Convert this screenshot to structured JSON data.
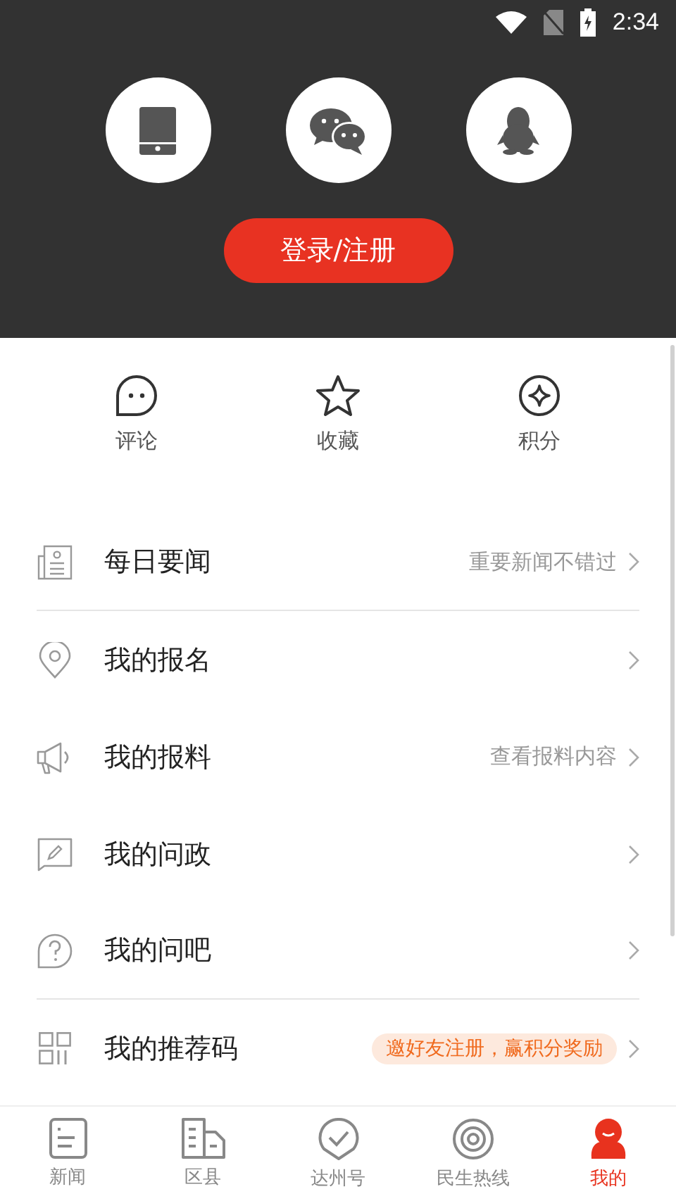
{
  "status_bar": {
    "time": "2:34"
  },
  "login": {
    "button": "登录/注册"
  },
  "quick_actions": [
    {
      "label": "评论"
    },
    {
      "label": "收藏"
    },
    {
      "label": "积分"
    }
  ],
  "menu": [
    {
      "title": "每日要闻",
      "hint": "重要新闻不错过",
      "divider_after": true
    },
    {
      "title": "我的报名",
      "divider_after": false
    },
    {
      "title": "我的报料",
      "hint": "查看报料内容",
      "divider_after": false
    },
    {
      "title": "我的问政",
      "divider_after": false
    },
    {
      "title": "我的问吧",
      "divider_after": true
    },
    {
      "title": "我的推荐码",
      "badge": "邀好友注册，赢积分奖励",
      "divider_after": false
    }
  ],
  "tabs": [
    {
      "label": "新闻",
      "selected": false
    },
    {
      "label": "区县",
      "selected": false
    },
    {
      "label": "达州号",
      "selected": false
    },
    {
      "label": "民生热线",
      "selected": false
    },
    {
      "label": "我的",
      "selected": true
    }
  ]
}
